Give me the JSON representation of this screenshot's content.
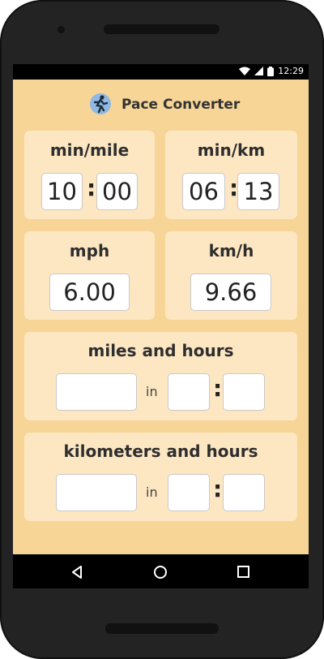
{
  "status": {
    "time": "12:29"
  },
  "app": {
    "title": "Pace Converter"
  },
  "min_mile": {
    "label": "min/mile",
    "minutes": "10",
    "seconds": "00"
  },
  "min_km": {
    "label": "min/km",
    "minutes": "06",
    "seconds": "13"
  },
  "mph": {
    "label": "mph",
    "value": "6.00"
  },
  "kmh": {
    "label": "km/h",
    "value": "9.66"
  },
  "miles_hours": {
    "label": "miles and hours",
    "distance": "",
    "in_label": "in",
    "hours": "",
    "minutes": ""
  },
  "km_hours": {
    "label": "kilometers and hours",
    "distance": "",
    "in_label": "in",
    "hours": "",
    "minutes": ""
  },
  "colon": ":",
  "icons": [
    "wifi-icon",
    "signal-icon",
    "battery-icon",
    "runner-icon",
    "back-icon",
    "home-icon",
    "recents-icon"
  ]
}
